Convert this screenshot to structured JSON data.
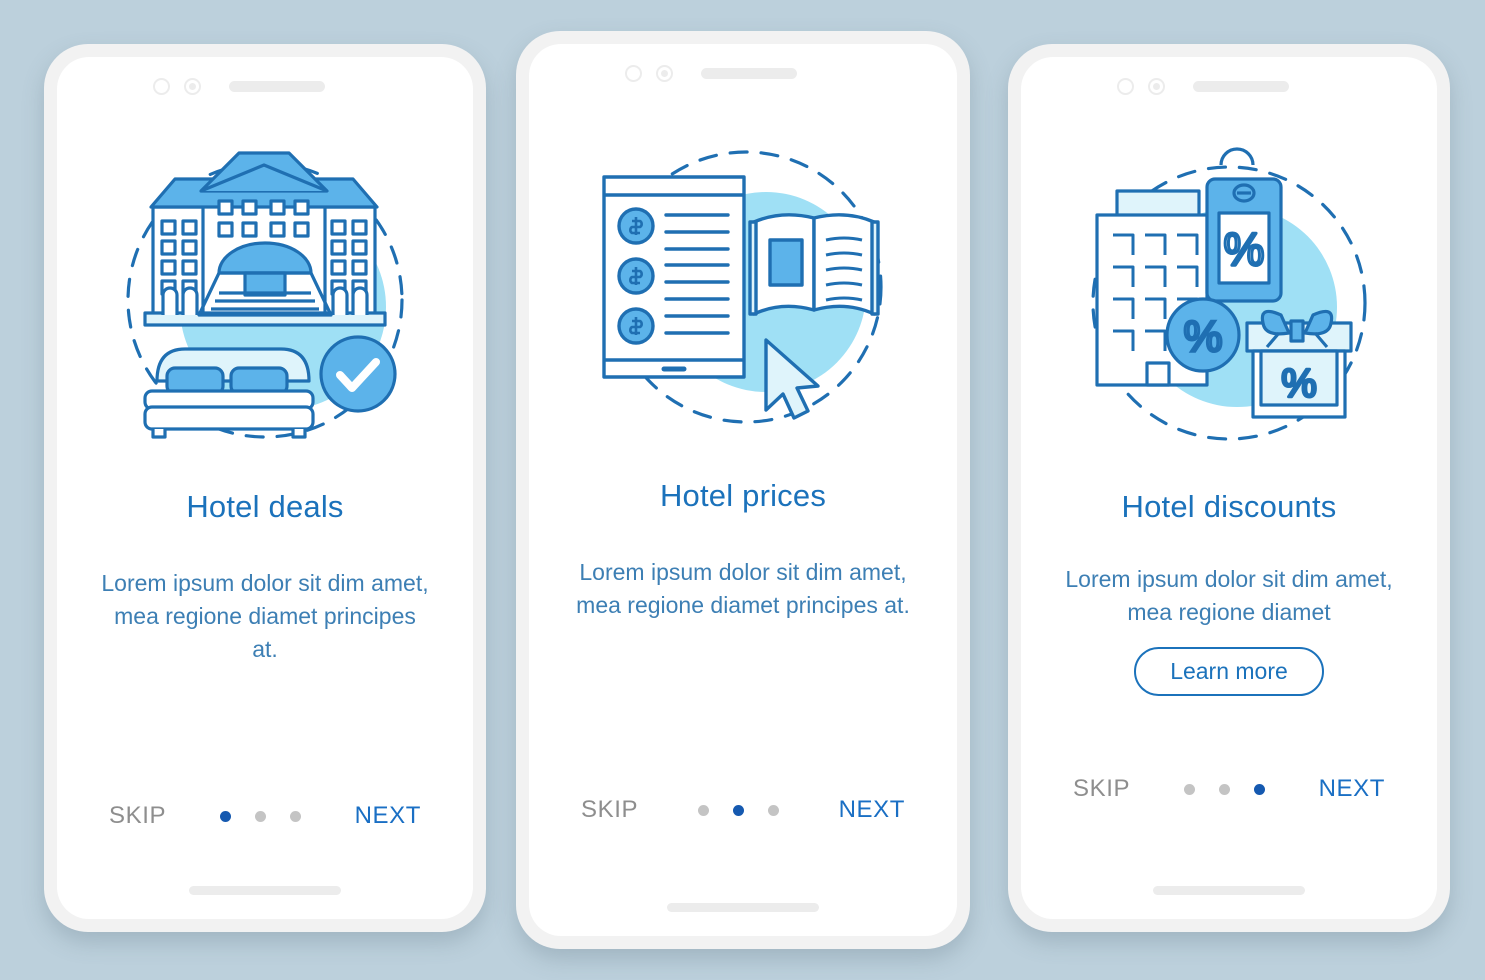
{
  "background_color": "#bcd0dc",
  "theme": {
    "title_color": "#1b72bb",
    "body_color": "#3d7fb4",
    "next_color": "#1a6fc4",
    "skip_color": "#8e8e8e",
    "active_dot_color": "#1559b0",
    "inactive_dot_color": "#c4c4c4",
    "accent_light": "#9fe0f5",
    "accent_mid": "#5cb3ea",
    "accent_stroke": "#1f6fb2",
    "phone_bezel": "#f2f2f2",
    "screen": "#ffffff"
  },
  "screens": [
    {
      "id": "hotel-deals",
      "illustration": "hotel-bed-check-illustration",
      "title": "Hotel deals",
      "description": "Lorem ipsum dolor sit dim amet, mea regione diamet principes at.",
      "has_learn_more": false,
      "learn_more_label": "",
      "skip_label": "SKIP",
      "next_label": "NEXT",
      "dots": [
        true,
        false,
        false
      ],
      "step": 1,
      "total_steps": 3
    },
    {
      "id": "hotel-prices",
      "illustration": "tablet-book-cursor-illustration",
      "title": "Hotel prices",
      "description": "Lorem ipsum dolor sit dim amet, mea regione diamet principes at.",
      "has_learn_more": false,
      "learn_more_label": "",
      "skip_label": "SKIP",
      "next_label": "NEXT",
      "dots": [
        false,
        true,
        false
      ],
      "step": 2,
      "total_steps": 3
    },
    {
      "id": "hotel-discounts",
      "illustration": "building-tag-gift-percent-illustration",
      "title": "Hotel discounts",
      "description": "Lorem ipsum dolor sit dim amet, mea regione diamet",
      "has_learn_more": true,
      "learn_more_label": "Learn more",
      "skip_label": "SKIP",
      "next_label": "NEXT",
      "dots": [
        false,
        false,
        true
      ],
      "step": 3,
      "total_steps": 3
    }
  ]
}
